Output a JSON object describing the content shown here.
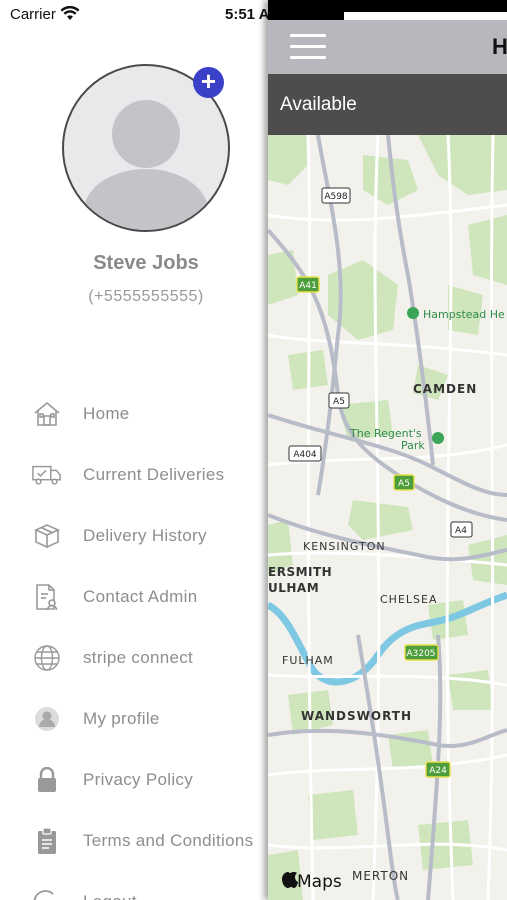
{
  "status_bar": {
    "carrier": "Carrier",
    "time": "5:51 A"
  },
  "profile": {
    "name": "Steve Jobs",
    "phone": "(+5555555555)",
    "add_badge": "+"
  },
  "menu": {
    "items": [
      {
        "label": "Home",
        "icon": "house-icon"
      },
      {
        "label": "Current Deliveries",
        "icon": "delivery-truck-icon"
      },
      {
        "label": "Delivery History",
        "icon": "package-box-icon"
      },
      {
        "label": "Contact Admin",
        "icon": "contact-document-icon"
      },
      {
        "label": "stripe connect",
        "icon": "globe-icon"
      },
      {
        "label": "My profile",
        "icon": "user-avatar-icon"
      },
      {
        "label": "Privacy Policy",
        "icon": "lock-icon"
      },
      {
        "label": "Terms and Conditions",
        "icon": "clipboard-icon"
      },
      {
        "label": "Logout",
        "icon": "logout-icon"
      }
    ]
  },
  "main": {
    "title": "H",
    "availability": "Available"
  },
  "map": {
    "labels": {
      "a598": "A598",
      "a41": "A41",
      "hampstead": "Hampstead He",
      "camden": "CAMDEN",
      "a5_top": "A5",
      "regents_park_1": "The Regent's",
      "regents_park_2": "Park",
      "a404": "A404",
      "a5_mid": "A5",
      "a4": "A4",
      "kensington": "KENSINGTON",
      "hammersmith": "ERSMITH",
      "fulham_upper": "ULHAM",
      "chelsea": "CHELSEA",
      "a3205": "A3205",
      "fulham": "FULHAM",
      "wandsworth": "WANDSWORTH",
      "a24": "A24",
      "merton": "MERTON",
      "maps_logo": "Maps"
    }
  },
  "colors": {
    "accent_badge": "#3b40c9",
    "nav_bar": "#b7b7bd",
    "avail_bar": "#4d4d4d",
    "menu_text": "#8e8e8e",
    "map_park": "#c9e4b4",
    "map_water": "#7ec8e3",
    "map_primary_road_badge": "#4d9e3a"
  }
}
